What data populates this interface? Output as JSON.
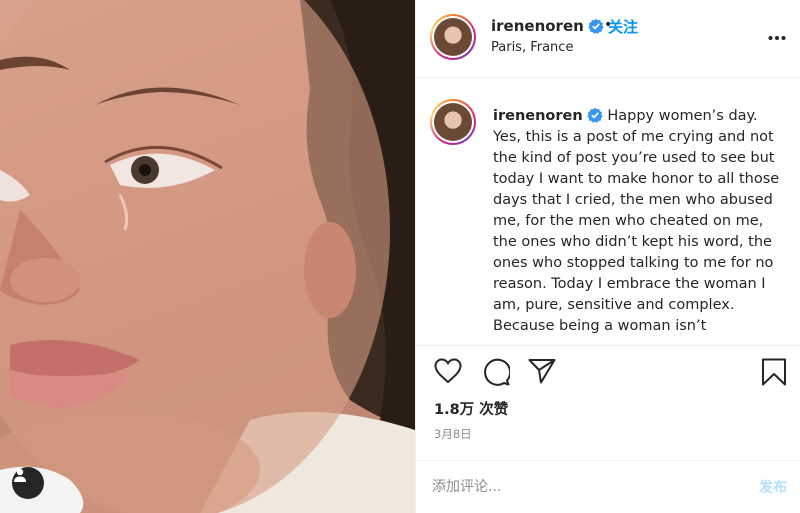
{
  "post": {
    "photo_alt": "",
    "user_tag_icon": "person-icon"
  },
  "header": {
    "username": "irenenoren",
    "separator": "•",
    "follow_label": "关注",
    "location": "Paris, France"
  },
  "caption": {
    "username": "irenenoren",
    "text": "Happy women’s day. Yes, this is a post of me crying and not the kind of post you’re used to see but today I want to make honor to all those days that I cried, the men who abused me, for the men who cheated on me, the ones who didn’t kept his word, the ones who stopped talking to me for no reason. Today I embrace the woman I am, pure, sensitive and complex. Because being a woman isn’t"
  },
  "actions": {
    "like_icon": "heart-icon",
    "comment_icon": "comment-icon",
    "share_icon": "paper-plane-icon",
    "save_icon": "bookmark-icon"
  },
  "likes": "1.8万 次赞",
  "date": "3月8日",
  "comment": {
    "placeholder": "添加评论...",
    "post_label": "发布"
  },
  "colors": {
    "link_blue": "#0095f6",
    "post_disabled": "#b2dffc",
    "verified_blue": "#3897f0"
  }
}
